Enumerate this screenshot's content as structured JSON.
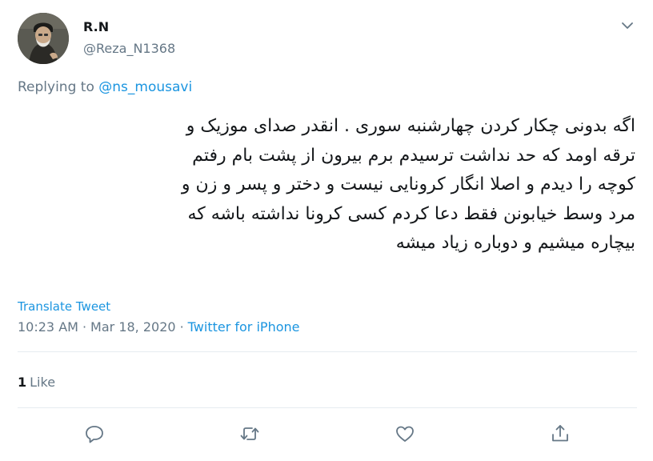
{
  "user": {
    "display_name": "R.N",
    "handle": "@Reza_N1368"
  },
  "reply": {
    "prefix": "Replying to ",
    "mention": "@ns_mousavi"
  },
  "tweet": {
    "lines": [
      "اگه بدونی چکار کردن چهارشنبه سوری . انقدر صدای موزیک و",
      "ترقه اومد که حد نداشت ترسیدم برم بیرون از پشت بام رفتم",
      "کوچه را دیدم و اصلا انگار کرونایی نیست و دختر و پسر و زن و",
      "مرد وسط خیابونن فقط دعا کردم کسی کرونا نداشته باشه که",
      "بیچاره میشیم و دوباره زیاد میشه"
    ]
  },
  "translate_label": "Translate Tweet",
  "meta": {
    "time": "10:23 AM",
    "separator": "·",
    "date": "Mar 18, 2020",
    "source": "Twitter for iPhone"
  },
  "stats": {
    "likes_count": "1",
    "likes_label": "Like"
  },
  "actions": [
    "reply-icon",
    "retweet-icon",
    "like-icon",
    "share-icon"
  ],
  "colors": {
    "link": "#1b95e0",
    "secondary_text": "#657786",
    "primary_text": "#14171a",
    "divider": "#e6ecf0"
  }
}
